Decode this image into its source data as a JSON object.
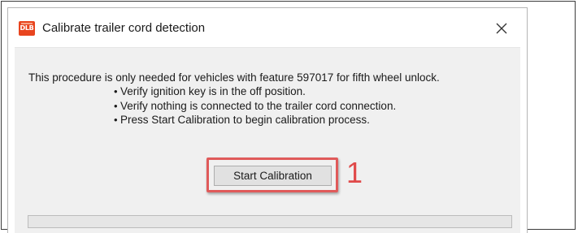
{
  "window": {
    "title": "Calibrate trailer cord detection",
    "icon_text": "DLB",
    "icon_color": "#e8451f"
  },
  "content": {
    "intro": "This procedure is only needed for vehicles with feature 597017 for fifth wheel unlock.",
    "bullets": [
      "Verify ignition key is in the off position.",
      "Verify nothing is connected to the trailer cord connection.",
      "Press Start Calibration to begin calibration process."
    ],
    "start_button_label": "Start Calibration",
    "annotation_number": "1",
    "annotation_color": "#e05a5a",
    "progress": 0
  }
}
